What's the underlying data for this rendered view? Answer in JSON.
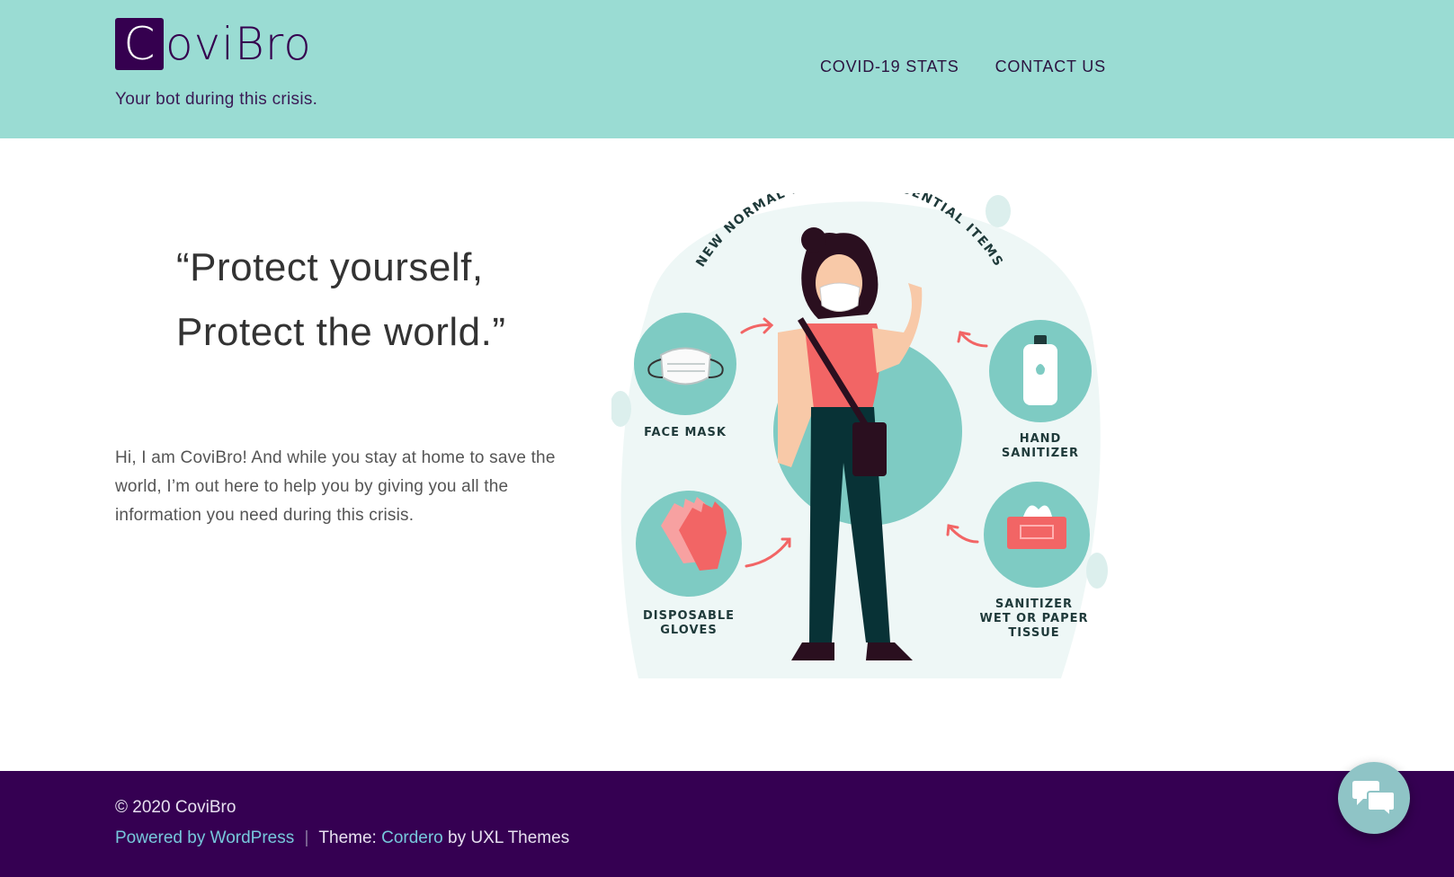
{
  "header": {
    "logo_initial": "C",
    "logo_rest": "oviBro",
    "tagline": "Your bot during this crisis.",
    "nav": [
      {
        "label": "COVID-19 STATS"
      },
      {
        "label": "CONTACT US"
      }
    ]
  },
  "main": {
    "quote_line1": "“Protect yourself,",
    "quote_line2": "Protect the world.”",
    "intro": "Hi, I am CoviBro! And while you stay at home to save the world, I’m out here to help you by giving you all the information you need during this crisis."
  },
  "illustration": {
    "arc_title": "NEW NORMAL LIFESTYLE ESSENTIAL ITEMS",
    "items": {
      "face_mask": "FACE MASK",
      "hand_sanitizer_1": "HAND",
      "hand_sanitizer_2": "SANITIZER",
      "gloves_1": "DISPOSABLE",
      "gloves_2": "GLOVES",
      "tissue_1": "SANITIZER",
      "tissue_2": "WET OR PAPER",
      "tissue_3": "TISSUE"
    }
  },
  "footer": {
    "copyright": "© 2020 CoviBro",
    "powered_by": "Powered by WordPress",
    "separator": "|",
    "theme_prefix": "Theme:",
    "theme_name": "Cordero",
    "theme_suffix": "by UXL Themes"
  },
  "colors": {
    "header_bg": "#9adcd3",
    "brand_purple": "#35004f",
    "footer_bg": "#350052",
    "link": "#77c8dc",
    "teal": "#7ecbc3",
    "coral": "#f26565"
  },
  "chat_button": {
    "icon": "chat-bubbles-icon"
  }
}
